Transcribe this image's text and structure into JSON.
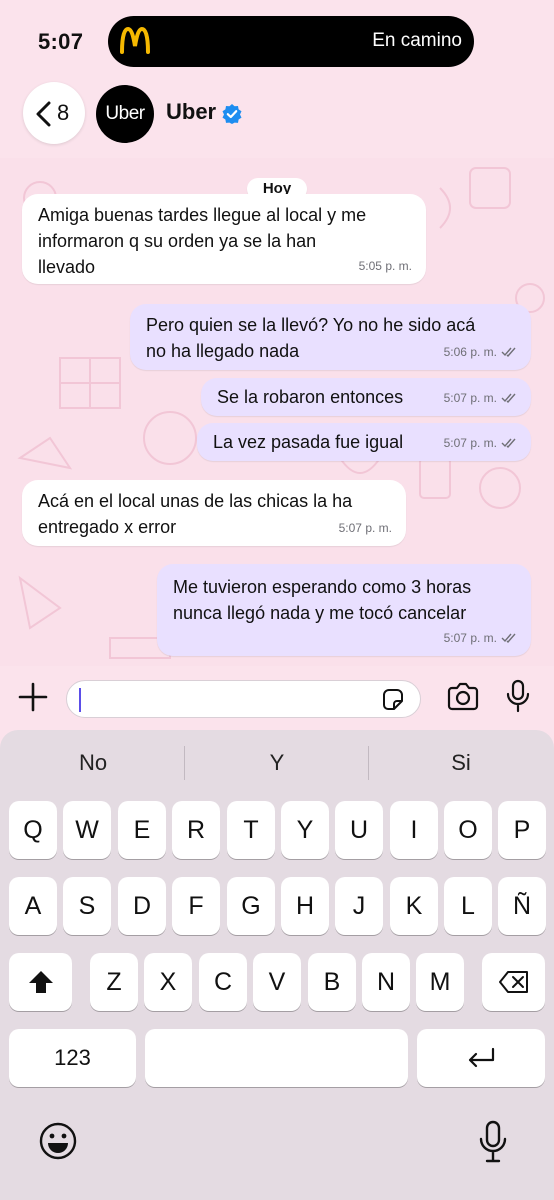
{
  "status_bar": {
    "time": "5:07",
    "live_activity": {
      "app_icon": "mcdonalds-logo",
      "status": "En camino"
    }
  },
  "header": {
    "back_count": "8",
    "avatar_text": "Uber",
    "contact_name": "Uber",
    "verified_icon": "verified-badge-icon"
  },
  "chat": {
    "day_label": "Hoy",
    "messages": [
      {
        "direction": "in",
        "lines": [
          "Amiga buenas tardes llegue al local y me",
          "informaron q su orden ya se la han",
          "llevado"
        ],
        "time": "5:05 p. m."
      },
      {
        "direction": "out",
        "lines": [
          "Pero quien se la llevó? Yo no he sido acá",
          "no ha llegado nada"
        ],
        "time": "5:06 p. m.",
        "read": true
      },
      {
        "direction": "out",
        "lines": [
          "Se la robaron entonces"
        ],
        "time": "5:07 p. m.",
        "read": true
      },
      {
        "direction": "out",
        "lines": [
          "La vez pasada fue igual"
        ],
        "time": "5:07 p. m.",
        "read": true
      },
      {
        "direction": "in",
        "lines": [
          "Acá en el local unas de las chicas la ha",
          "entregado x error"
        ],
        "time": "5:07 p. m."
      },
      {
        "direction": "out",
        "lines": [
          "Me tuvieron esperando como 3 horas",
          "nunca llegó nada y me tocó cancelar"
        ],
        "time": "5:07 p. m.",
        "read": true
      }
    ]
  },
  "input": {
    "value": "",
    "placeholder": ""
  },
  "keyboard": {
    "suggestions": [
      "No",
      "Y",
      "Si"
    ],
    "row1": [
      "Q",
      "W",
      "E",
      "R",
      "T",
      "Y",
      "U",
      "I",
      "O",
      "P"
    ],
    "row2": [
      "A",
      "S",
      "D",
      "F",
      "G",
      "H",
      "J",
      "K",
      "L",
      "Ñ"
    ],
    "row3": [
      "Z",
      "X",
      "C",
      "V",
      "B",
      "N",
      "M"
    ],
    "numbers_key": "123",
    "accent_color": "#5b4ee8"
  }
}
